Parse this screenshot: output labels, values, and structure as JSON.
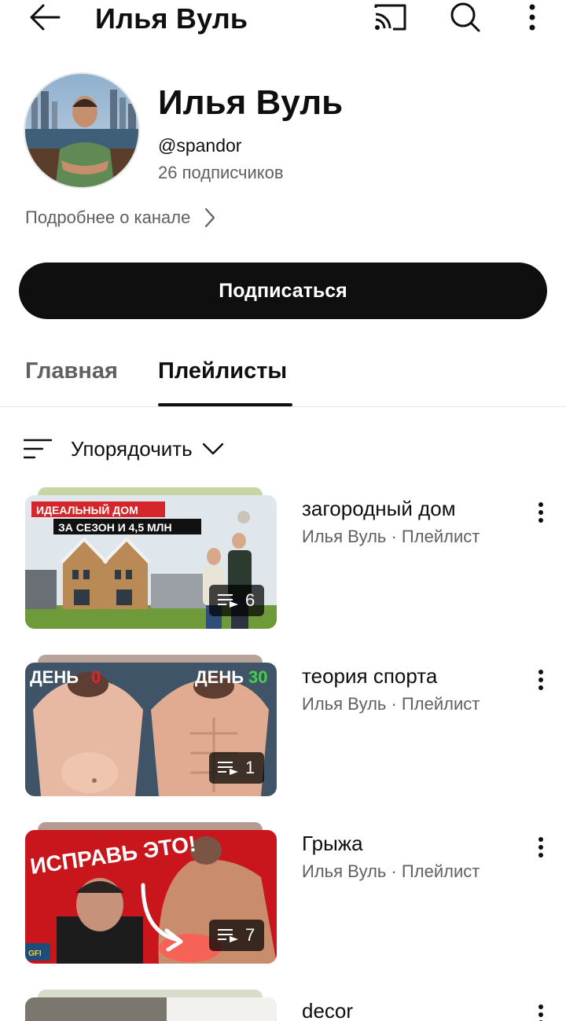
{
  "topbar": {
    "title": "Илья Вуль",
    "icons": [
      "back-arrow-icon",
      "cast-icon",
      "search-icon",
      "more-vertical-icon"
    ]
  },
  "channel": {
    "name": "Илья Вуль",
    "handle": "@spandor",
    "subscribers": "26 подписчиков",
    "about_link": "Подробнее о канале"
  },
  "subscribe_button": "Подписаться",
  "tabs": [
    {
      "label": "Главная",
      "active": false
    },
    {
      "label": "Плейлисты",
      "active": true
    }
  ],
  "sort": {
    "label": "Упорядочить"
  },
  "playlists": [
    {
      "title": "загородный дом",
      "meta": "Илья Вуль · Плейлист",
      "count": "6",
      "thumb_text": [
        "ИДЕАЛЬНЫЙ ДОМ",
        "ЗА СЕЗОН И 4,5 МЛН"
      ]
    },
    {
      "title": "теория спорта",
      "meta": "Илья Вуль · Плейлист",
      "count": "1",
      "thumb_text": [
        "ДЕНЬ",
        "0",
        "ДЕНЬ",
        "30"
      ]
    },
    {
      "title": "Грыжа",
      "meta": "Илья Вуль · Плейлист",
      "count": "7",
      "thumb_text": [
        "ИСПРАВЬ ЭТО!"
      ]
    },
    {
      "title": "decor",
      "meta": "",
      "count": "",
      "thumb_text": []
    }
  ],
  "colors": {
    "text_primary": "#0f0f0f",
    "text_secondary": "#606060",
    "button_bg": "#0f0f0f",
    "divider": "#e5e5e5"
  }
}
